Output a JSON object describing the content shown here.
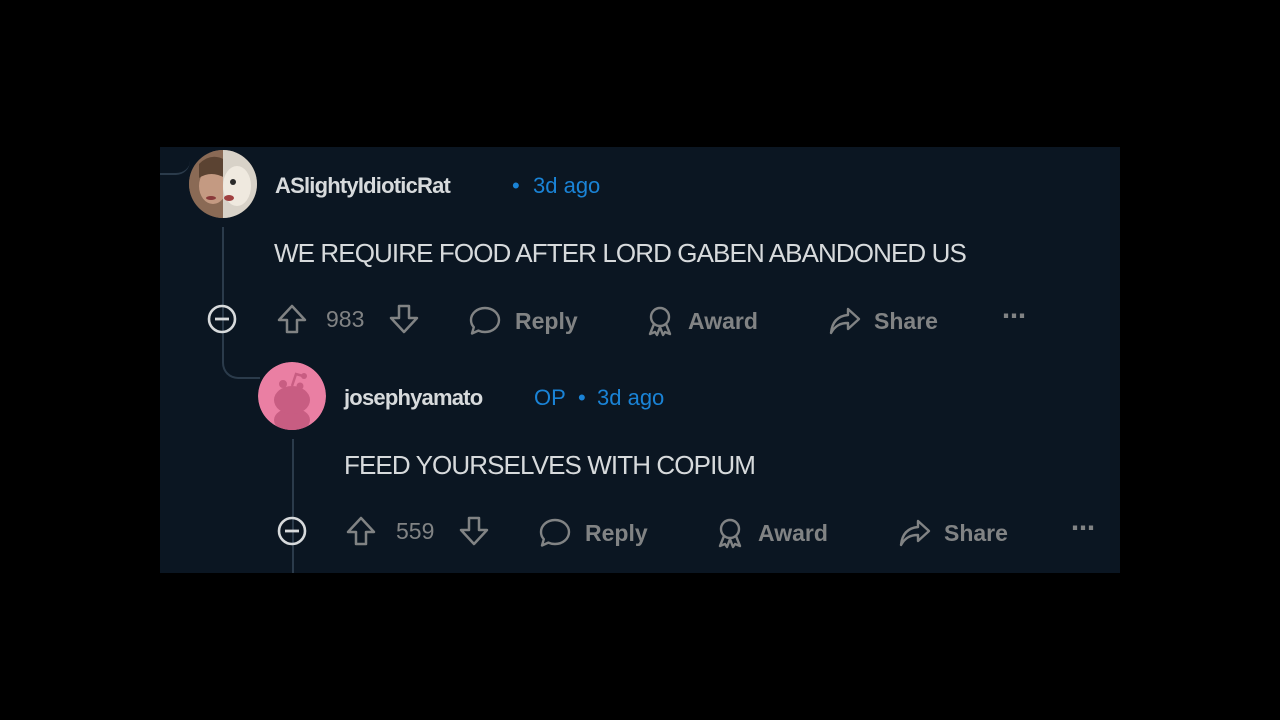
{
  "comments": [
    {
      "username": "ASlightyIdioticRat",
      "op_badge": "",
      "separator": "•",
      "time": "3d ago",
      "text": "WE REQUIRE FOOD AFTER LORD GABEN ABANDONED US",
      "votes": "983",
      "actions": {
        "reply": "Reply",
        "award": "Award",
        "share": "Share",
        "more": "⋯"
      }
    },
    {
      "username": "josephyamato",
      "op_badge": "OP",
      "separator": "•",
      "time": "3d ago",
      "text": "FEED YOURSELVES WITH COPIUM",
      "votes": "559",
      "actions": {
        "reply": "Reply",
        "award": "Award",
        "share": "Share",
        "more": "⋯"
      }
    }
  ],
  "colors": {
    "background": "#000000",
    "panel": "#0b1622",
    "text": "#d7dadc",
    "muted": "#818384",
    "accent": "#1a83d6",
    "thread_line": "#2b3b4b"
  },
  "icons": [
    "collapse-icon",
    "upvote-icon",
    "downvote-icon",
    "comment-icon",
    "award-icon",
    "share-icon",
    "more-icon",
    "user-avatar",
    "default-snoo-avatar"
  ]
}
